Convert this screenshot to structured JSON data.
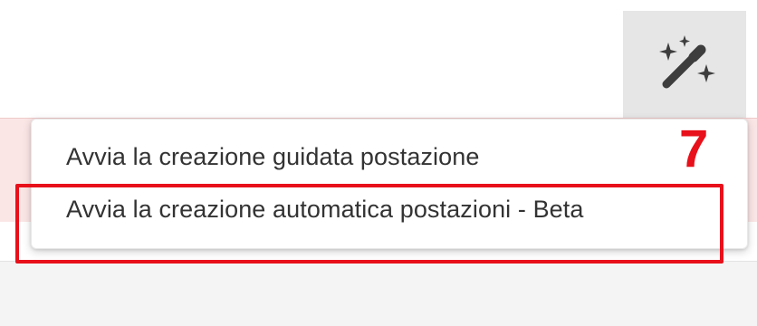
{
  "toolbar": {
    "magic_button_icon": "magic-wand-sparkles-icon"
  },
  "menu": {
    "items": [
      {
        "label": "Avvia la creazione guidata postazione"
      },
      {
        "label": "Avvia la creazione automatica postazioni - Beta"
      }
    ]
  },
  "annotation": {
    "callout_number": "7",
    "color": "#e8101a"
  }
}
